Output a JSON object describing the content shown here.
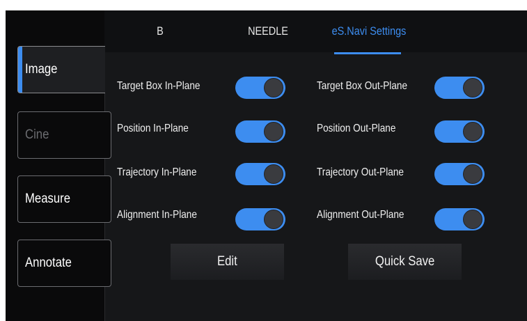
{
  "tabs": [
    {
      "label": "B"
    },
    {
      "label": "NEEDLE"
    },
    {
      "label": "eS.Navi Settings"
    }
  ],
  "side_menu": [
    {
      "label": "Image"
    },
    {
      "label": "Cine"
    },
    {
      "label": "Measure"
    },
    {
      "label": "Annotate"
    }
  ],
  "settings": {
    "left": [
      {
        "label": "Target Box In-Plane",
        "on": true
      },
      {
        "label": "Position In-Plane",
        "on": true
      },
      {
        "label": "Trajectory In-Plane",
        "on": true
      },
      {
        "label": "Alignment In-Plane",
        "on": true
      }
    ],
    "right": [
      {
        "label": "Target Box Out-Plane",
        "on": true
      },
      {
        "label": "Position Out-Plane",
        "on": true
      },
      {
        "label": "Trajectory Out-Plane",
        "on": true
      },
      {
        "label": "Alignment Out-Plane",
        "on": true
      }
    ]
  },
  "actions": {
    "edit_label": "Edit",
    "quick_save_label": "Quick Save"
  },
  "colors": {
    "accent": "#3d8df0",
    "background": "#0a0a0b",
    "panel": "#161719"
  }
}
